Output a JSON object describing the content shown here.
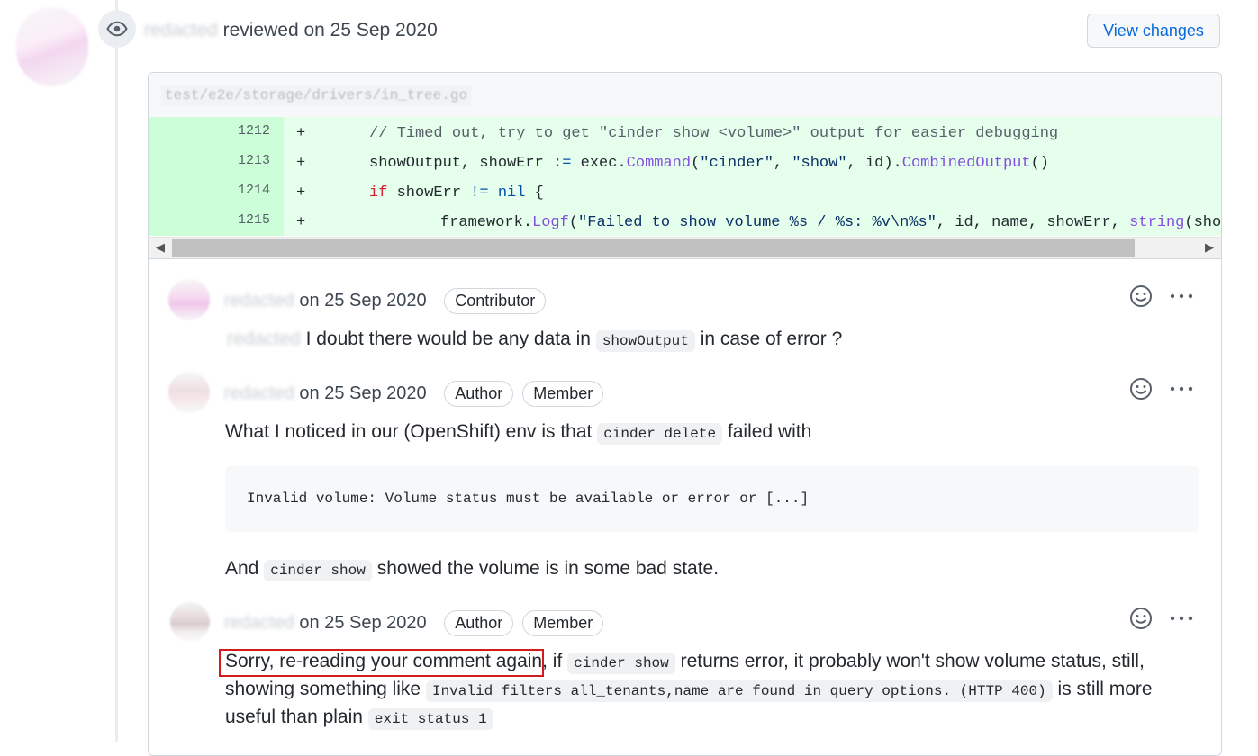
{
  "review": {
    "reviewer_name": "redacted",
    "action_text": "reviewed on 25 Sep 2020",
    "view_changes_label": "View changes"
  },
  "file": {
    "path": "test/e2e/storage/drivers/in_tree.go"
  },
  "diff_lines": [
    {
      "num": "1212",
      "sign": "+"
    },
    {
      "num": "1213",
      "sign": "+"
    },
    {
      "num": "1214",
      "sign": "+"
    },
    {
      "num": "1215",
      "sign": "+"
    }
  ],
  "comments": [
    {
      "author": "redacted",
      "date": "on 25 Sep 2020",
      "badges": [
        "Contributor"
      ],
      "text_before": "I doubt there would be any data in",
      "code1": "showOutput",
      "text_after": "in case of error ?"
    },
    {
      "author": "redacted",
      "date": "on 25 Sep 2020",
      "badges": [
        "Author",
        "Member"
      ],
      "line1_before": "What I noticed in our (OpenShift) env is that",
      "line1_code": "cinder delete",
      "line1_after": "failed with",
      "pre": "Invalid volume: Volume status must be available or error or [...]",
      "line2_before": "And",
      "line2_code": "cinder show",
      "line2_after": "showed the volume is in some bad state."
    },
    {
      "author": "redacted",
      "date": "on 25 Sep 2020",
      "badges": [
        "Author",
        "Member"
      ],
      "highlighted": "Sorry, re-reading your comment again",
      "after_highlight": ", if",
      "code1": "cinder show",
      "text1": "returns error, it probably won't show volume status, still,",
      "line2_before": "showing something like",
      "code2": "Invalid filters all_tenants,name are found in query options. (HTTP 400)",
      "line2_after": "is still more",
      "line3_before": "useful than plain",
      "code3": "exit status 1"
    }
  ],
  "icons": {
    "eye": "eye-icon",
    "smile": "smiley-icon",
    "more": "kebab-horizontal-icon"
  },
  "colors": {
    "link": "#0969da",
    "diff_add_bg": "#e6ffec",
    "diff_add_num_bg": "#ccffd8",
    "highlight": "#d41a1a"
  }
}
